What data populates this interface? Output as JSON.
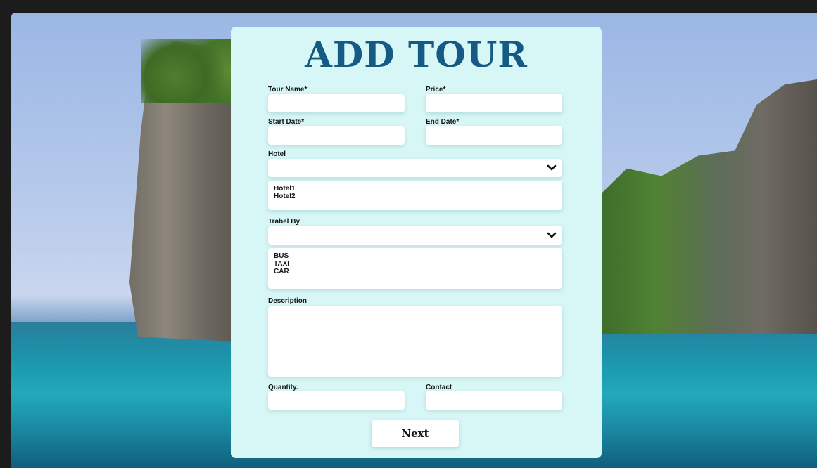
{
  "form": {
    "title": "ADD TOUR",
    "tour_name_label": "Tour Name*",
    "price_label": "Price*",
    "start_date_label": "Start Date*",
    "end_date_label": "End Date*",
    "hotel_label": "Hotel",
    "hotel_options": [
      "Hotel1",
      "Hotel2"
    ],
    "travel_by_label": "Trabel By",
    "travel_options": [
      "BUS",
      "TAXI",
      "CAR"
    ],
    "description_label": "Description",
    "quantity_label": "Quantity.",
    "contact_label": "Contact",
    "next_label": "Next"
  },
  "icons": {
    "hotel_select": "chevron-down-icon",
    "travel_select": "chevron-down-icon"
  },
  "colors": {
    "title": "#155a85",
    "card_background": "#d7f6f6",
    "field_background": "#ffffff"
  }
}
